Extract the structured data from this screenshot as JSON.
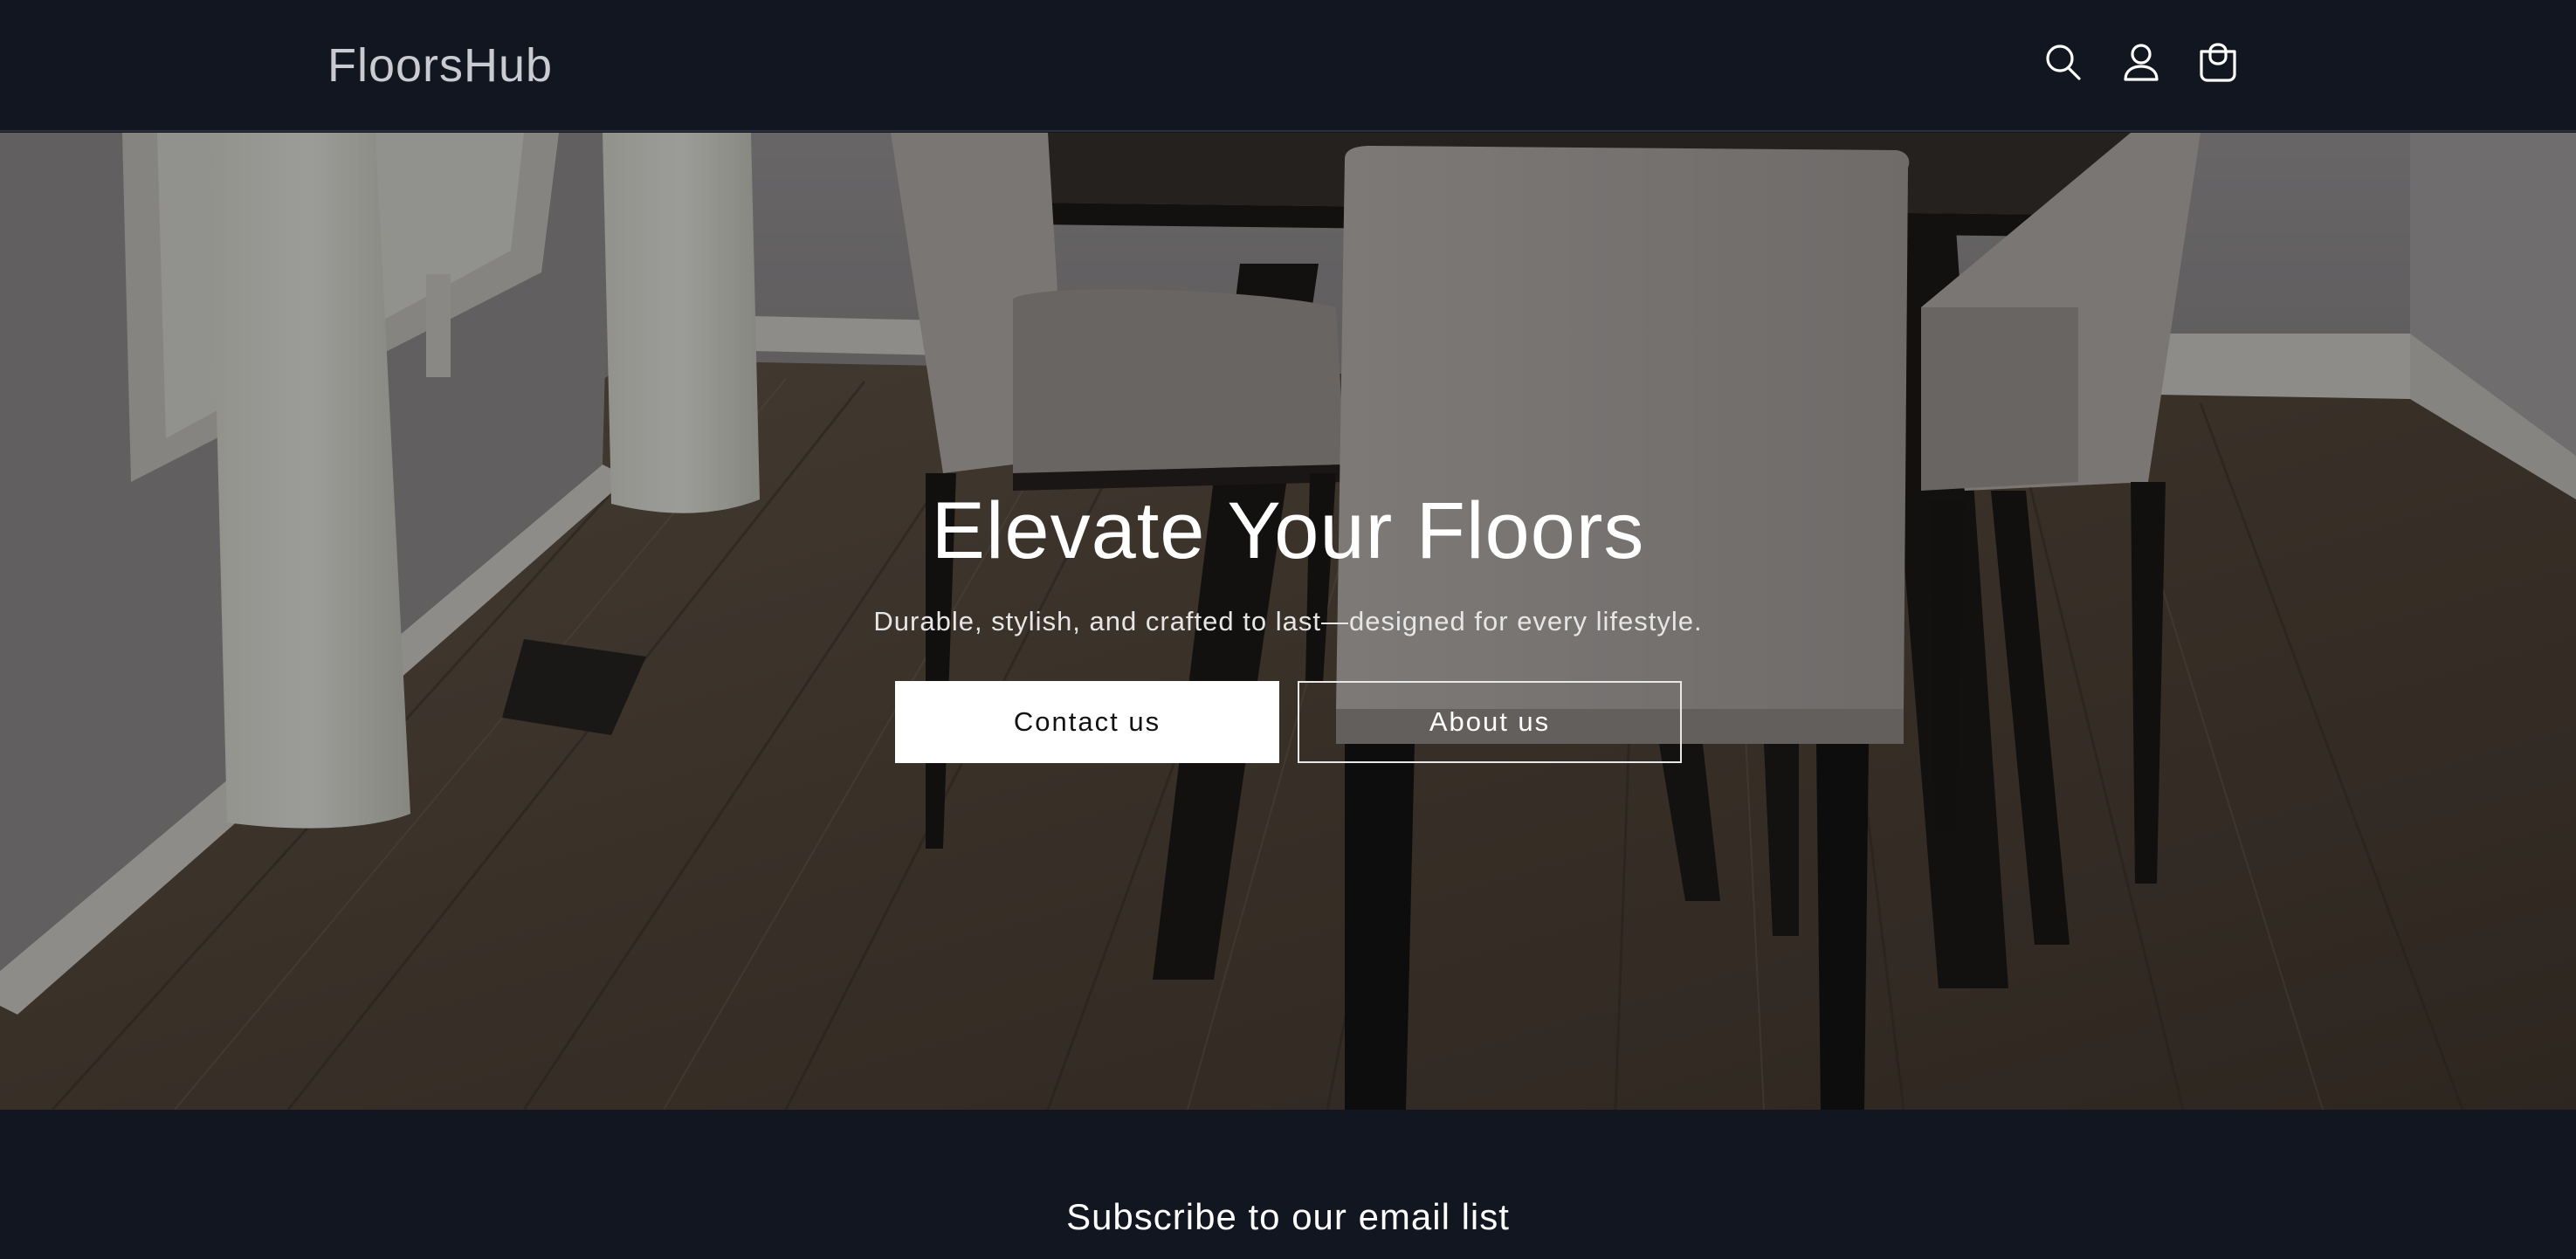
{
  "header": {
    "brand": "FloorsHub",
    "icons": [
      "search-icon",
      "account-icon",
      "cart-icon"
    ]
  },
  "hero": {
    "title": "Elevate Your Floors",
    "subtitle": "Durable, stylish, and crafted to last—designed for every lifestyle.",
    "primary_button": "Contact us",
    "secondary_button": "About us"
  },
  "newsletter": {
    "title": "Subscribe to our email list"
  },
  "colors": {
    "header_bg": "#121620",
    "text_light": "#ffffff",
    "brand_text": "#c9cbd0",
    "button_primary_bg": "#ffffff"
  }
}
